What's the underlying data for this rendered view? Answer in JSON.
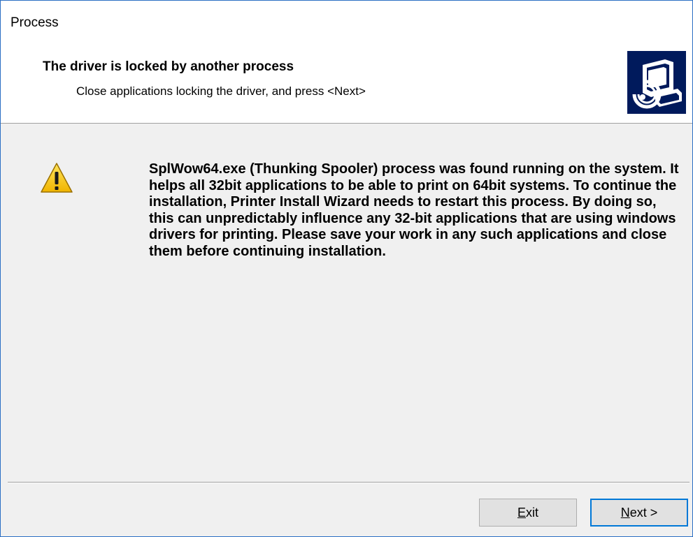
{
  "window": {
    "title": "Process"
  },
  "header": {
    "heading": "The driver is locked by another process",
    "subheading": "Close applications locking the driver, and press <Next>",
    "icon": "printer-setup-icon"
  },
  "content": {
    "icon": "warning-icon",
    "message": "SplWow64.exe (Thunking Spooler) process was found running on the system. It helps all 32bit applications to be able to print on 64bit systems. To continue the installation, Printer Install Wizard needs to restart this process. By doing so, this can unpredictably influence any 32-bit applications that are using windows drivers for printing. Please save your work in any such applications and close them before continuing installation."
  },
  "buttons": {
    "exit_mnemonic": "E",
    "exit_rest": "xit",
    "next_mnemonic": "N",
    "next_rest": "ext >"
  },
  "colors": {
    "accent": "#0078d7",
    "window_border": "#2b6fc4",
    "warning_yellow": "#f5c400",
    "icon_background": "#001a5c"
  }
}
